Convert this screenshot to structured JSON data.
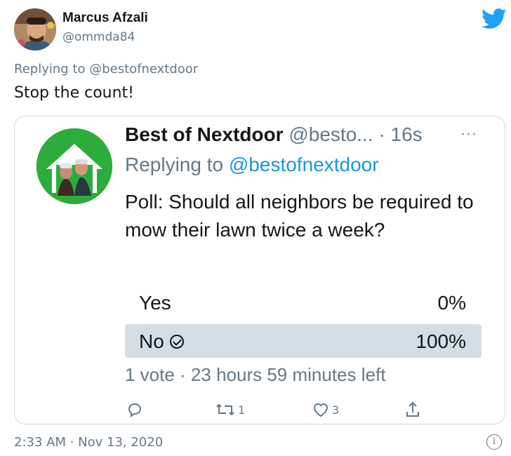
{
  "tweet": {
    "author_name": "Marcus Afzali",
    "author_handle": "@ommda84",
    "replying_prefix": "Replying to ",
    "replying_handle": "@bestofnextdoor",
    "text": "Stop the count!",
    "timestamp": "2:33 AM · Nov 13, 2020",
    "info_icon": "i"
  },
  "quoted": {
    "author_name": "Best of Nextdoor",
    "author_handle_time": " @besto... · 16s",
    "more": "···",
    "replying_prefix": "Replying to ",
    "replying_handle": "@bestofnextdoor",
    "text": "Poll: Should all neighbors be required to mow their lawn twice a week?",
    "poll": {
      "options": [
        {
          "label": "Yes",
          "percent": "0%"
        },
        {
          "label": "No",
          "percent": "100%"
        }
      ],
      "summary": "1 vote · 23 hours 59 minutes left"
    },
    "actions": {
      "reply_count": "",
      "retweet_count": "1",
      "like_count": "3"
    }
  },
  "colors": {
    "twitter_blue": "#1da1f2",
    "link_blue": "#1b95e0",
    "secondary_text": "#657786",
    "nextdoor_green": "#2cac3c",
    "poll_winner_bg": "#d5dde4"
  }
}
